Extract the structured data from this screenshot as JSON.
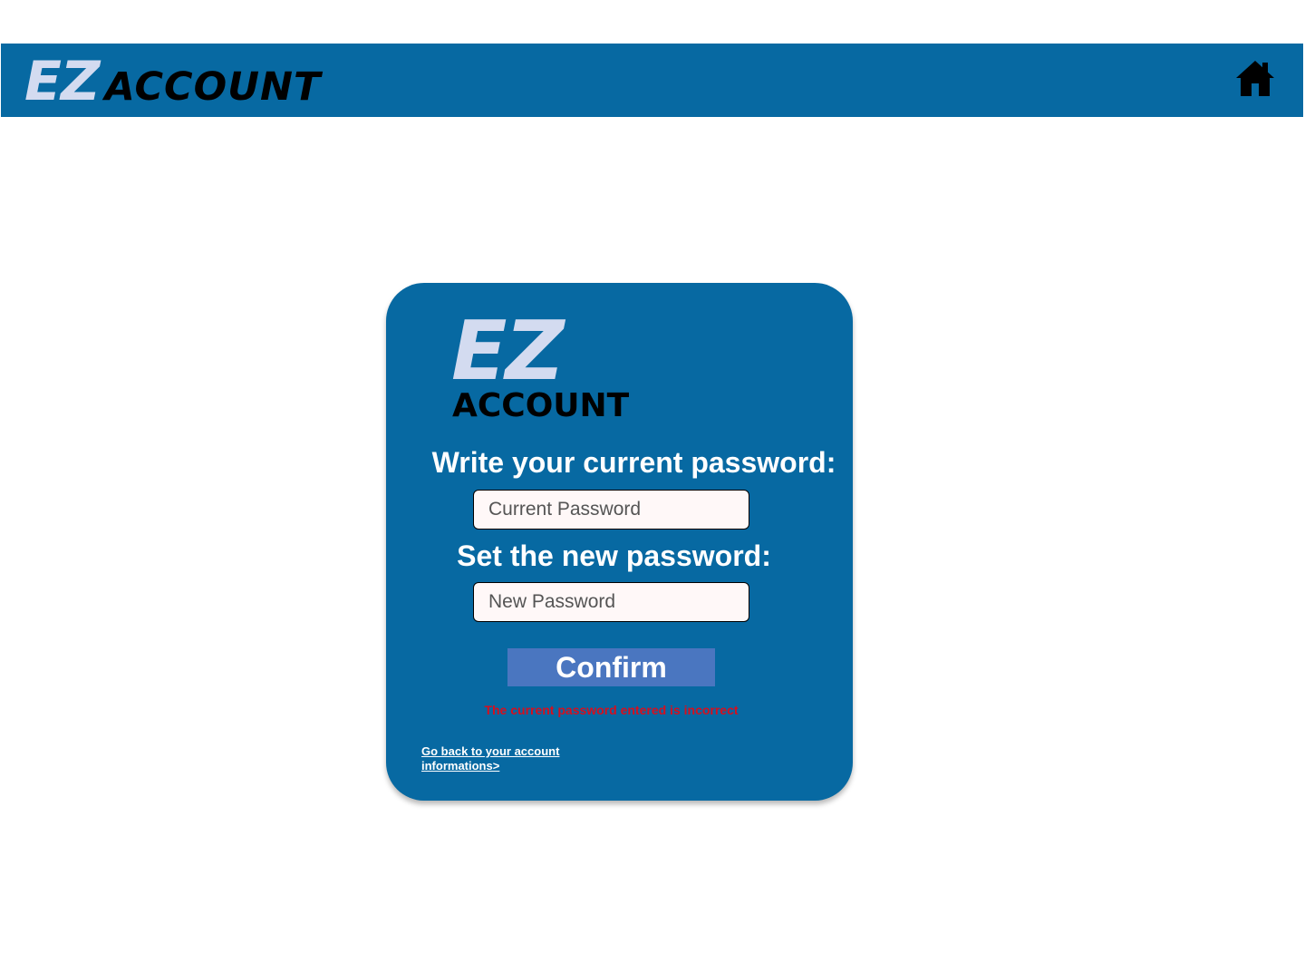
{
  "header": {
    "logo_primary": "EZ",
    "logo_secondary": "ACCOUNT",
    "home_icon": "home-icon",
    "background_color": "#0769a2"
  },
  "card": {
    "logo_primary": "EZ",
    "logo_secondary": "ACCOUNT",
    "current_password_label": "Write your current password:",
    "current_password_placeholder": "Current Password",
    "current_password_value": "",
    "new_password_label": "Set the new password:",
    "new_password_placeholder": "New Password",
    "new_password_value": "",
    "confirm_label": "Confirm",
    "error_message": "The current password entered is incorrect",
    "back_link_label": "Go back to your account informations>"
  },
  "colors": {
    "brand_blue": "#0769a2",
    "logo_light": "#d3dbf0",
    "button_blue": "#4a76c0",
    "error_red": "#d60f1e"
  }
}
